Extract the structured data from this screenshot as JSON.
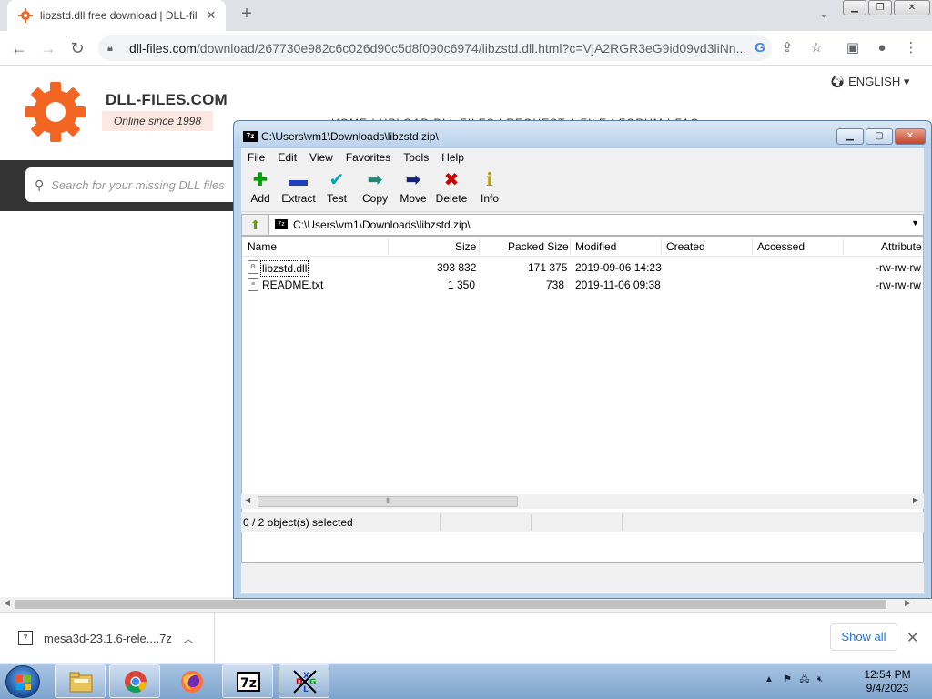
{
  "browser": {
    "tab_title": "libzstd.dll free download | DLL-fil",
    "new_tab_label": "+",
    "url_host": "dll-files.com",
    "url_path": "/download/267730e982c6c026d90c5d8f090c6974/libzstd.dll.html?c=VjA2RGR3eG9id09vd3liNn...",
    "icons": [
      "back-arrow-icon",
      "forward-arrow-icon",
      "reload-icon",
      "lock-icon",
      "google-icon",
      "share-icon",
      "star-icon",
      "sidepanel-icon",
      "profile-icon",
      "menu-icon"
    ]
  },
  "site": {
    "brand": "DLL-FILES.COM",
    "tagline": "Online since 1998",
    "language": "ENGLISH",
    "search_placeholder": "Search for your missing DLL files",
    "accent_color": "#f26522"
  },
  "zip_window": {
    "title": "C:\\Users\\vm1\\Downloads\\libzstd.zip\\",
    "menu": [
      "File",
      "Edit",
      "View",
      "Favorites",
      "Tools",
      "Help"
    ],
    "toolbar": [
      {
        "label": "Add",
        "icon": "plus-icon",
        "color": "#00a000"
      },
      {
        "label": "Extract",
        "icon": "minus-icon",
        "color": "#1f3fbf"
      },
      {
        "label": "Test",
        "icon": "check-icon",
        "color": "#00a3b8"
      },
      {
        "label": "Copy",
        "icon": "copy-arrow-icon",
        "color": "#1f8a7a"
      },
      {
        "label": "Move",
        "icon": "move-arrow-icon",
        "color": "#10237a"
      },
      {
        "label": "Delete",
        "icon": "delete-x-icon",
        "color": "#d00000"
      },
      {
        "label": "Info",
        "icon": "info-icon",
        "color": "#b59b00"
      }
    ],
    "address": "C:\\Users\\vm1\\Downloads\\libzstd.zip\\",
    "columns": [
      "Name",
      "Size",
      "Packed Size",
      "Modified",
      "Created",
      "Accessed",
      "Attribute"
    ],
    "files": [
      {
        "name": "libzstd.dll",
        "size": "393 832",
        "packed": "171 375",
        "modified": "2019-09-06 14:23",
        "created": "",
        "accessed": "",
        "attr": "-rw-rw-rw"
      },
      {
        "name": "README.txt",
        "size": "1 350",
        "packed": "738",
        "modified": "2019-11-06 09:38",
        "created": "",
        "accessed": "",
        "attr": "-rw-rw-rw"
      }
    ],
    "status": "0 / 2 object(s) selected"
  },
  "downloads": {
    "file": "mesa3d-23.1.6-rele....7z",
    "show_all": "Show all"
  },
  "taskbar": {
    "apps": [
      "windows-explorer-icon",
      "chrome-icon",
      "firefox-icon",
      "7zip-icon",
      "dependencies-app-icon"
    ],
    "time": "12:54 PM",
    "date": "9/4/2023"
  }
}
